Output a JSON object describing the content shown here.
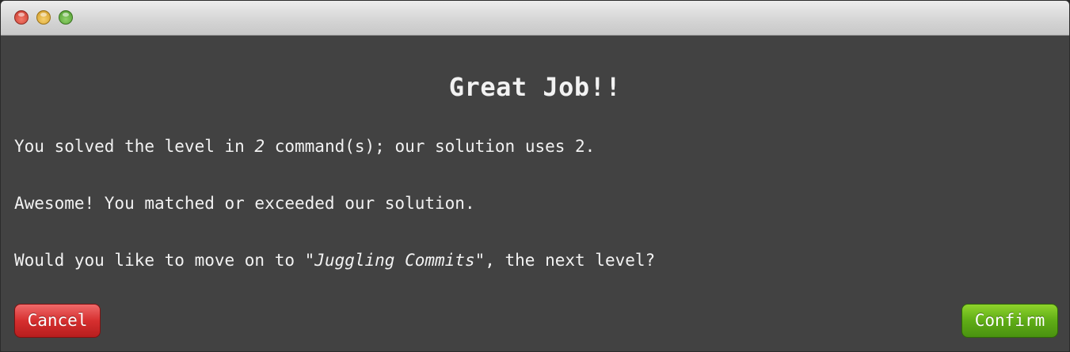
{
  "dialog": {
    "title": "Great Job!!",
    "line1": {
      "prefix": "You solved the level in ",
      "count": "2",
      "suffix": " command(s); our solution uses 2."
    },
    "line2": "Awesome! You matched or exceeded our solution.",
    "line3": {
      "prefix": "Would you like to move on to ",
      "level_name": "\"Juggling Commits\"",
      "suffix": ", the next level?"
    }
  },
  "buttons": {
    "cancel_label": "Cancel",
    "confirm_label": "Confirm"
  },
  "colors": {
    "background": "#424242",
    "cancel": "#d62f2f",
    "confirm": "#5fac16"
  }
}
